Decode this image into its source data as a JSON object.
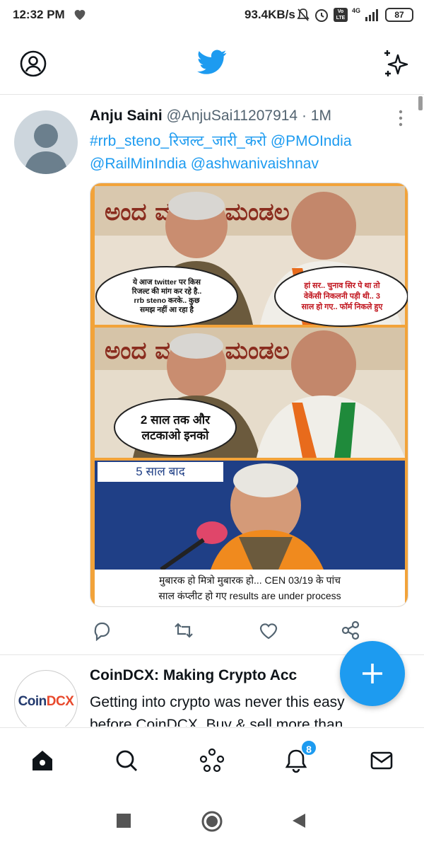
{
  "status_bar": {
    "time": "12:32 PM",
    "network_speed": "93.4KB/s",
    "signal_label": "4G",
    "volte_label": "Vo LTE",
    "battery": "87",
    "icons": [
      "heart-icon",
      "mute-icon",
      "alarm-icon",
      "volte-icon",
      "signal-icon",
      "battery-icon"
    ]
  },
  "top_bar": {
    "icons": [
      "profile-icon",
      "twitter-bird-icon",
      "sparkle-icon"
    ],
    "accent_color": "#1d9bf0"
  },
  "tweet": {
    "author_name": "Anju Saini",
    "handle": "@AnjuSai11207914",
    "dot": "·",
    "time": "1M",
    "text_line1": "#rrb_steno_रिजल्ट_जारी_करो @PMOIndia",
    "text_line2": "@RailMinIndia @ashwanivaishnav",
    "media": {
      "panel1_left_bubble": [
        "ये आज twitter पर किस",
        "रिजल्ट की मांग कर रहे है..",
        "rrb steno करके.. कुछ",
        "समझ नहीं आ रहा है"
      ],
      "panel1_right_bubble": [
        "हां सर.. चुनाव सिर पे था तो",
        "वेकेंसी निकलनी पड़ी थी.. 3",
        "साल हो गए.. फॉर्म निकले हुए"
      ],
      "panel2_bubble": [
        "2 साल तक और",
        "लटकाओ इनको"
      ],
      "panel3_label": "5 साल बाद",
      "caption": [
        "मुबारक हो मित्रो मुबारक हो...  CEN 03/19 के पांच",
        "साल कंप्लीट हो गए results are under process"
      ]
    },
    "actions": [
      "reply-icon",
      "retweet-icon",
      "like-icon",
      "share-icon"
    ]
  },
  "promo": {
    "logo_text_a": "Coin",
    "logo_text_b": "DCX",
    "title": "CoinDCX: Making Crypto Acc",
    "body_line1": "Getting into crypto was never this easy",
    "body_line2": "before CoinDCX. Buy & sell more than"
  },
  "fab": {
    "icon": "compose-plus-icon"
  },
  "bottom_nav": {
    "items": [
      "home-icon",
      "search-icon",
      "spaces-icon",
      "notifications-icon",
      "messages-icon"
    ],
    "notification_count": "8"
  },
  "system_nav": [
    "recent-apps-icon",
    "home-circle-icon",
    "back-icon"
  ]
}
